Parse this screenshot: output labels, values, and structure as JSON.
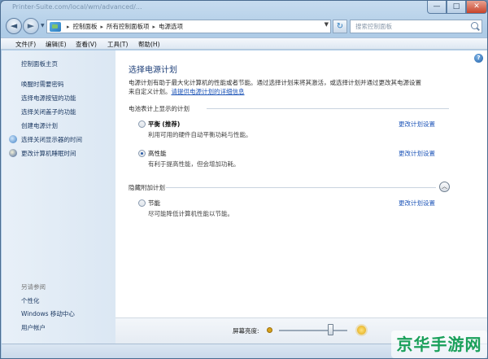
{
  "window": {
    "title": "Printer-Suite.com/local/wm/advanced/...",
    "controls": {
      "minimize": "—",
      "maximize": "□",
      "close": "✕"
    }
  },
  "nav": {
    "back": "◄",
    "forward": "►",
    "breadcrumbs": [
      "控制面板",
      "所有控制面板项",
      "电源选项"
    ],
    "refresh": "↻",
    "search_placeholder": "搜索控制面板"
  },
  "menu": {
    "items": [
      "文件(F)",
      "编辑(E)",
      "查看(V)",
      "工具(T)",
      "帮助(H)"
    ]
  },
  "sidebar": {
    "home": "控制面板主页",
    "links": [
      "唤醒时需要密码",
      "选择电源按钮的功能",
      "选择关闭盖子的功能",
      "创建电源计划",
      "选择关闭显示器的时间",
      "更改计算机睡眠时间"
    ],
    "see_also_heading": "另请参阅",
    "see_also": [
      "个性化",
      "Windows 移动中心",
      "用户帐户"
    ]
  },
  "main": {
    "help": "?",
    "title": "选择电源计划",
    "intro_line1": "电源计划有助于最大化计算机的性能或者节能。通过选择计划来将其激活，或选择计划并通过更改其电源设置",
    "intro_line2_prefix": "来自定义计划。",
    "intro_link": "请提供电源计划的详细信息",
    "battery_group": "电池表计上显示的计划",
    "plans": [
      {
        "name": "平衡",
        "tag": "(推荐)",
        "desc": "利用可用的硬件自动平衡功耗与性能。",
        "link": "更改计划设置",
        "selected": false
      },
      {
        "name": "高性能",
        "tag": "",
        "desc": "有利于提高性能，但会增加功耗。",
        "link": "更改计划设置",
        "selected": true
      }
    ],
    "hidden_group": "隐藏附加计划",
    "collapse": "︿",
    "hidden_plans": [
      {
        "name": "节能",
        "desc": "尽可能降低计算机性能以节能。",
        "link": "更改计划设置",
        "selected": false
      }
    ]
  },
  "brightness": {
    "label": "屏幕亮度:",
    "level_fraction": 0.75
  },
  "watermark": "京华手游网"
}
